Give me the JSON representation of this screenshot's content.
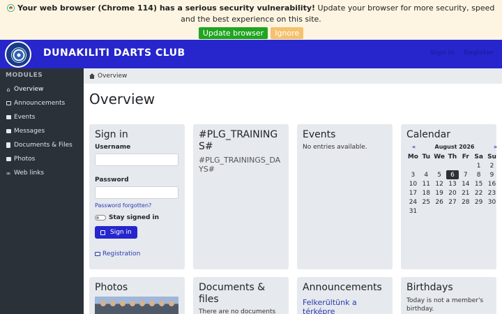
{
  "banner": {
    "bold_text": "Your web browser (Chrome 114) has a serious security vulnerability!",
    "text": "Update your browser for more security, speed and the best experience on this site.",
    "update_label": "Update browser",
    "ignore_label": "Ignore"
  },
  "header": {
    "title": "DUNAKILITI DARTS CLUB",
    "signin_label": "Sign in",
    "register_label": "Register"
  },
  "sidebar": {
    "title": "MODULES",
    "items": [
      {
        "label": "Overview",
        "icon": "home-icon"
      },
      {
        "label": "Announcements",
        "icon": "newspaper-icon"
      },
      {
        "label": "Events",
        "icon": "ticket-icon"
      },
      {
        "label": "Messages",
        "icon": "envelope-icon"
      },
      {
        "label": "Documents & Files",
        "icon": "file-icon"
      },
      {
        "label": "Photos",
        "icon": "image-icon"
      },
      {
        "label": "Web links",
        "icon": "link-icon"
      }
    ]
  },
  "breadcrumb": {
    "label": "Overview"
  },
  "page": {
    "title": "Overview"
  },
  "signin": {
    "title": "Sign in",
    "username_label": "Username",
    "password_label": "Password",
    "forgot_label": "Password forgotten?",
    "stay_label": "Stay signed in",
    "button_label": "Sign in",
    "registration_label": "Registration"
  },
  "training": {
    "title": "#PLG_TRAININGS#",
    "days": "#PLG_TRAININGS_DAYS#"
  },
  "events": {
    "title": "Events",
    "empty": "No entries available."
  },
  "calendar": {
    "title": "Calendar",
    "prev": "«",
    "next": "»",
    "month": "August 2026",
    "weekdays": [
      "Mo",
      "Tu",
      "We",
      "Th",
      "Fr",
      "Sa",
      "Su"
    ],
    "weeks": [
      [
        "",
        "",
        "",
        "",
        "",
        "1",
        "2"
      ],
      [
        "3",
        "4",
        "5",
        "6",
        "7",
        "8",
        "9"
      ],
      [
        "10",
        "11",
        "12",
        "13",
        "14",
        "15",
        "16"
      ],
      [
        "17",
        "18",
        "19",
        "20",
        "21",
        "22",
        "23"
      ],
      [
        "24",
        "25",
        "26",
        "27",
        "28",
        "29",
        "30"
      ],
      [
        "31",
        "",
        "",
        "",
        "",
        "",
        ""
      ]
    ],
    "today": "6"
  },
  "photos": {
    "title": "Photos"
  },
  "documents": {
    "title": "Documents & files",
    "empty": "There are no documents or"
  },
  "announcements": {
    "title": "Announcements",
    "item": "Felkerültünk a térképre"
  },
  "birthdays": {
    "title": "Birthdays",
    "text": "Today is not a member's birthday."
  },
  "colors": {
    "accent": "#2626cc",
    "sidebar": "#2b3138",
    "banner": "#fdf5e2",
    "update": "#20a520",
    "ignore": "#f5c16c"
  }
}
